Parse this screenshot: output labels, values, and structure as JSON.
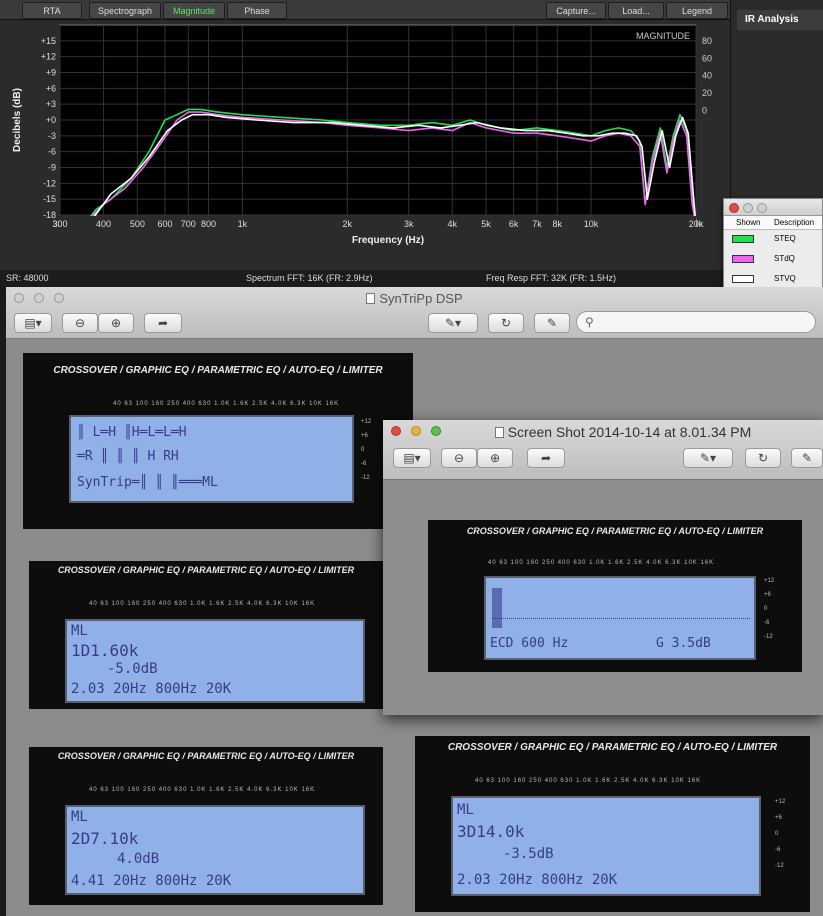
{
  "analyzer": {
    "tabs": [
      {
        "label": "RTA",
        "active": false
      },
      {
        "label": "Spectrograph",
        "active": false
      },
      {
        "label": "Magnitude",
        "active": true
      },
      {
        "label": "Phase",
        "active": false
      }
    ],
    "right_tabs": [
      {
        "label": "Capture..."
      },
      {
        "label": "Load..."
      },
      {
        "label": "Legend"
      }
    ],
    "plot_label": "MAGNITUDE",
    "status": {
      "sr": "SR: 48000",
      "spectrum": "Spectrum FFT: 16K (FR: 2.9Hz)",
      "freq_resp": "Freq Resp FFT: 32K (FR: 1.5Hz)"
    }
  },
  "chart_data": {
    "type": "line",
    "title": "MAGNITUDE",
    "xlabel": "Frequency (Hz)",
    "ylabel": "Decibels (dB)",
    "xscale": "log",
    "xlim": [
      300,
      20000
    ],
    "ylim": [
      -18,
      18
    ],
    "x_ticks": [
      "300",
      "400",
      "500",
      "600",
      "700",
      "800",
      "1k",
      "2k",
      "3k",
      "4k",
      "5k",
      "6k",
      "7k",
      "8k",
      "10k",
      "20k"
    ],
    "y_ticks": [
      "+15",
      "+12",
      "+9",
      "+6",
      "+3",
      "+0",
      "-3",
      "-6",
      "-9",
      "-12",
      "-15",
      "-18"
    ],
    "y2_ticks": [
      "80",
      "60",
      "40",
      "20",
      "0"
    ],
    "grid": true,
    "series": [
      {
        "name": "STEQ",
        "color": "#22e04a",
        "x": [
          350,
          380,
          420,
          480,
          540,
          600,
          650,
          700,
          760,
          850,
          1000,
          1300,
          1700,
          2000,
          2500,
          3000,
          3500,
          4000,
          4500,
          5000,
          6000,
          7000,
          8000,
          9000,
          10000,
          11000,
          12000,
          13000,
          13800,
          14300,
          15000,
          15800,
          16500,
          17200,
          18000,
          18800,
          19500,
          20000
        ],
        "y": [
          -20,
          -17,
          -15,
          -11,
          -6,
          0,
          1,
          2,
          2,
          1.5,
          1,
          0.5,
          0,
          -0.5,
          -1,
          -1,
          -0.5,
          -1,
          0,
          -1,
          -2,
          -1.5,
          -2,
          -2.5,
          -3,
          -2,
          -1.5,
          -2,
          -4,
          -16,
          -7,
          -1.5,
          -9,
          -3,
          1,
          -2,
          -15,
          -20
        ]
      },
      {
        "name": "STdQ",
        "color": "#ee66ee",
        "x": [
          350,
          400,
          460,
          520,
          590,
          650,
          700,
          760,
          850,
          1000,
          1300,
          1700,
          2000,
          2500,
          3000,
          3500,
          4000,
          4500,
          5000,
          6000,
          7000,
          8000,
          9000,
          10000,
          11000,
          12000,
          13000,
          13800,
          14300,
          15000,
          15800,
          16500,
          17200,
          18000,
          18800,
          19500,
          20000
        ],
        "y": [
          -20,
          -16,
          -13,
          -9,
          -4,
          0,
          1.5,
          1.5,
          1,
          0.5,
          0,
          -0.5,
          -1,
          -1.5,
          -2,
          -1.5,
          -2,
          -0.5,
          -1.5,
          -2.5,
          -2.5,
          -3,
          -3.5,
          -4,
          -3,
          -2.5,
          -3,
          -5,
          -16,
          -8,
          -2.5,
          -10,
          -4,
          0,
          -3,
          -16,
          -20
        ]
      },
      {
        "name": "STVQ",
        "color": "#ffffff",
        "x": [
          360,
          420,
          480,
          540,
          610,
          670,
          720,
          800,
          900,
          1100,
          1400,
          1800,
          2200,
          2700,
          3200,
          3700,
          4200,
          4700,
          5500,
          6500,
          7500,
          8500,
          9500,
          10500,
          11500,
          12500,
          13500,
          14000,
          14500,
          15200,
          16000,
          16800,
          17500,
          18300,
          19000,
          19700,
          20000
        ],
        "y": [
          -20,
          -14,
          -11,
          -7,
          -2,
          0,
          1,
          1,
          0.5,
          0,
          -0.5,
          -0.5,
          -1,
          -1.5,
          -1,
          -1.5,
          -1,
          -0.5,
          -1.5,
          -2,
          -2,
          -2.5,
          -3,
          -3,
          -2.5,
          -2.5,
          -3,
          -5,
          -15,
          -8,
          -2,
          -9,
          -3,
          0.5,
          -2.5,
          -15,
          -20
        ]
      }
    ]
  },
  "ir_panel": {
    "title": "IR Analysis"
  },
  "legend": {
    "headers": [
      "Shown",
      "Description"
    ],
    "items": [
      {
        "name": "STEQ",
        "color": "#22e04a"
      },
      {
        "name": "STdQ",
        "color": "#ee66ee"
      },
      {
        "name": "STVQ",
        "color": "#ffffff"
      }
    ]
  },
  "dsp_window": {
    "title": "SynTriPp DSP"
  },
  "screenshot_window": {
    "title": "Screen Shot 2014-10-14 at 8.01.34 PM"
  },
  "photos": {
    "header": "CROSSOVER / GRAPHIC EQ / PARAMETRIC EQ / AUTO-EQ / LIMITER",
    "freqs": "40  63  100  160  250  400  630  1.0K  1.6K  2.5K  4.0K  6.3K  10K  16K",
    "db_marks": [
      "+12",
      "+6",
      "0",
      "-6",
      "-12"
    ],
    "lcd1": {
      "line1": "║ L═H ║H═L═L═H",
      "line2": "═R ║ ║ ║ H RH",
      "line3": "SynTrip═║ ║ ║═══ML"
    },
    "lcd2": {
      "line1": "ML",
      "line2": "1D1.60k",
      "line3": "-5.0dB",
      "line4": "2.03  20Hz 800Hz 20K"
    },
    "lcd3": {
      "line1": "ML",
      "line2": "2D7.10k",
      "line3": "4.0dB",
      "line4": "4.41  20Hz 800Hz 20K"
    },
    "lcd4": {
      "line1": "ECD 600 Hz",
      "line2": "G  3.5dB"
    },
    "lcd5": {
      "line1": "ML",
      "line2": "3D14.0k",
      "line3": "-3.5dB",
      "line4": "2.03  20Hz 800Hz 20K"
    }
  }
}
